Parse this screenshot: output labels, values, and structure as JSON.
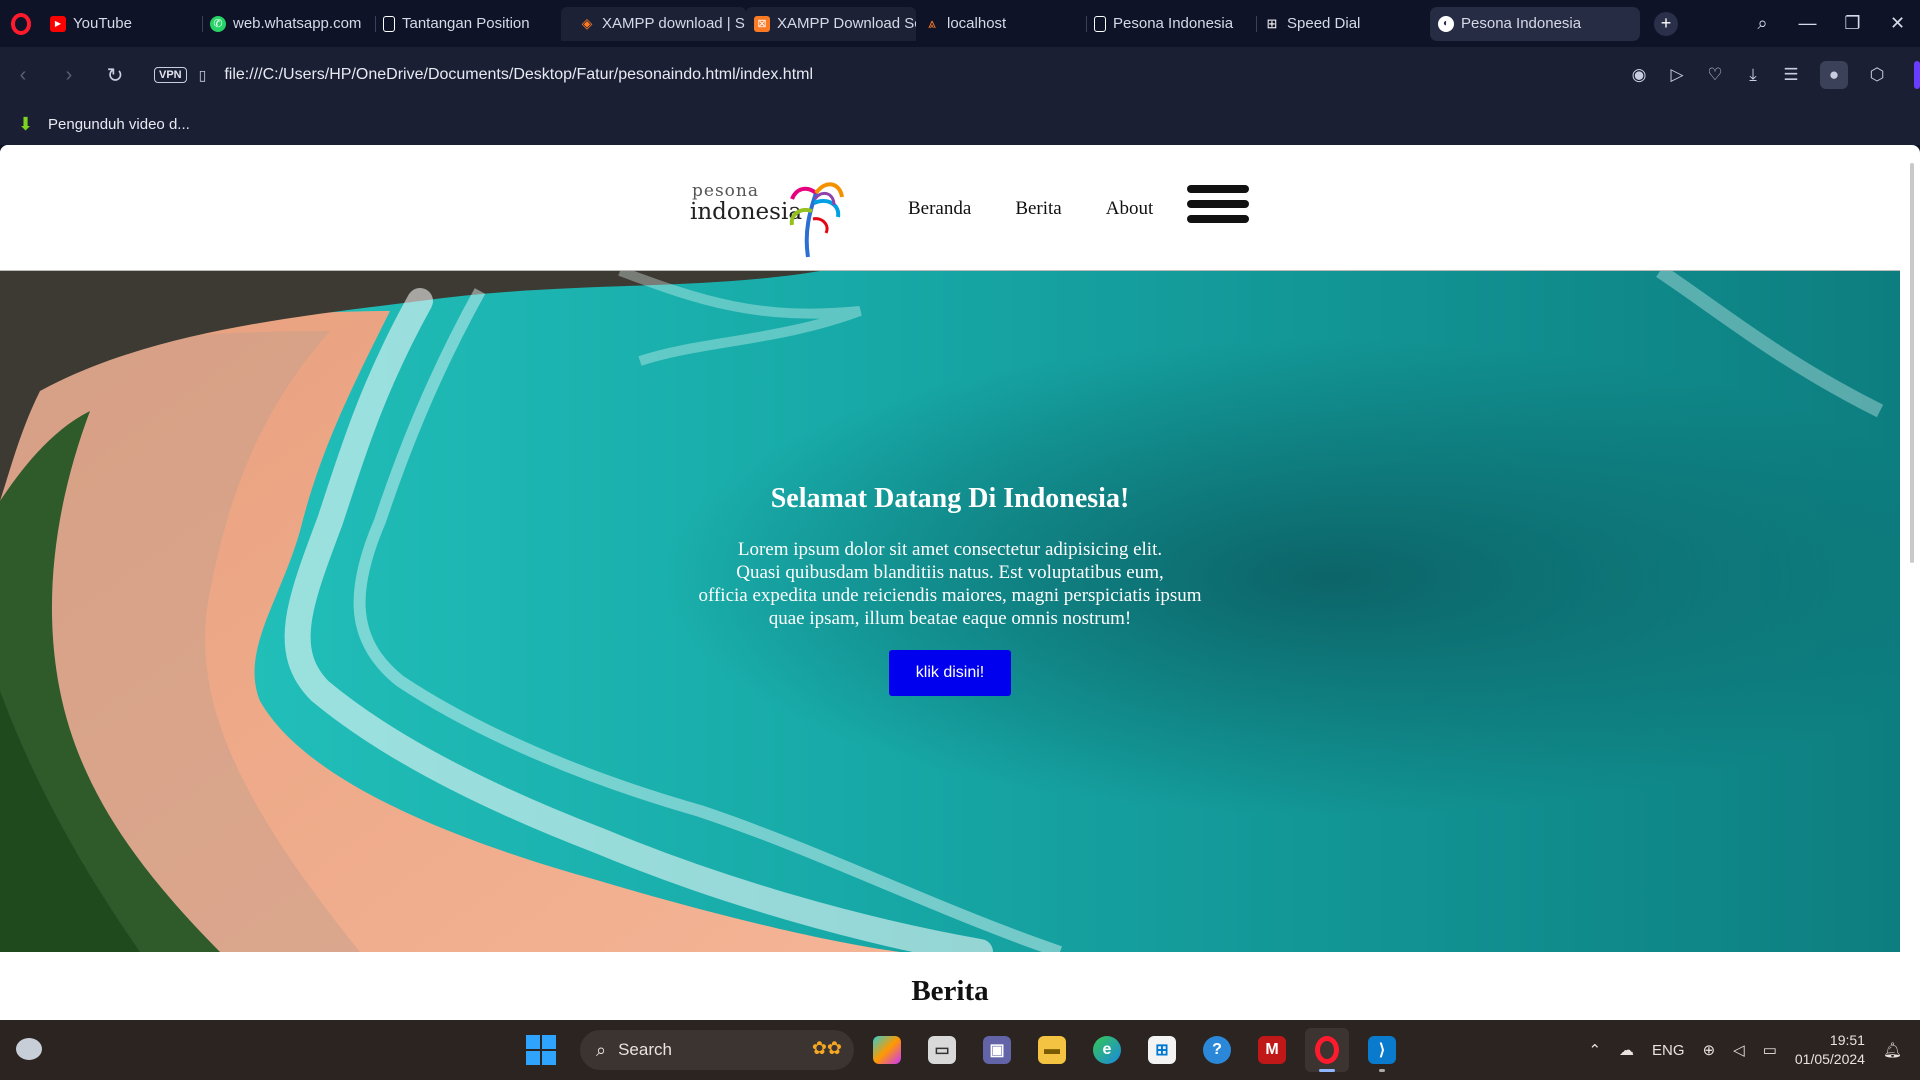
{
  "browser": {
    "tabs": [
      {
        "label": "YouTube",
        "icon": "youtube-icon",
        "color": "#ff0000"
      },
      {
        "label": "web.whatsapp.com",
        "icon": "whatsapp-icon",
        "color": "#25d366"
      },
      {
        "label": "Tantangan Position",
        "icon": "document-icon",
        "color": "#ffffff"
      },
      {
        "label": "XAMPP download | S",
        "icon": "xampp-icon",
        "color": "#fb7a24"
      },
      {
        "label": "XAMPP Download Sc",
        "icon": "xampp-icon",
        "color": "#fb7a24"
      },
      {
        "label": "localhost",
        "icon": "xampp-icon",
        "color": "#fb7a24"
      },
      {
        "label": "Pesona Indonesia",
        "icon": "document-icon",
        "color": "#ffffff"
      },
      {
        "label": "Speed Dial",
        "icon": "speed-dial-icon",
        "color": "#ffffff"
      },
      {
        "label": "Pesona Indonesia",
        "icon": "globe-icon",
        "color": "#ffffff"
      }
    ],
    "url": "file:///C:/Users/HP/OneDrive/Documents/Desktop/Fatur/pesonaindo.html/index.html",
    "vpn_label": "VPN",
    "bookmark_label": "Pengunduh video d..."
  },
  "site": {
    "logo_top": "pesona",
    "logo_bottom": "indonesia",
    "nav": [
      "Beranda",
      "Berita",
      "About"
    ],
    "hero": {
      "title": "Selamat Datang Di Indonesia!",
      "lines": [
        "Lorem ipsum dolor sit amet consectetur adipisicing elit.",
        "Quasi quibusdam blanditiis natus. Est voluptatibus eum,",
        "officia expedita unde reiciendis maiores, magni perspiciatis ipsum",
        "quae ipsam, illum beatae eaque omnis nostrum!"
      ],
      "button": "klik disini!"
    },
    "section_title": "Berita"
  },
  "taskbar": {
    "search_label": "Search",
    "language": "ENG",
    "time": "19:51",
    "date": "01/05/2024"
  }
}
